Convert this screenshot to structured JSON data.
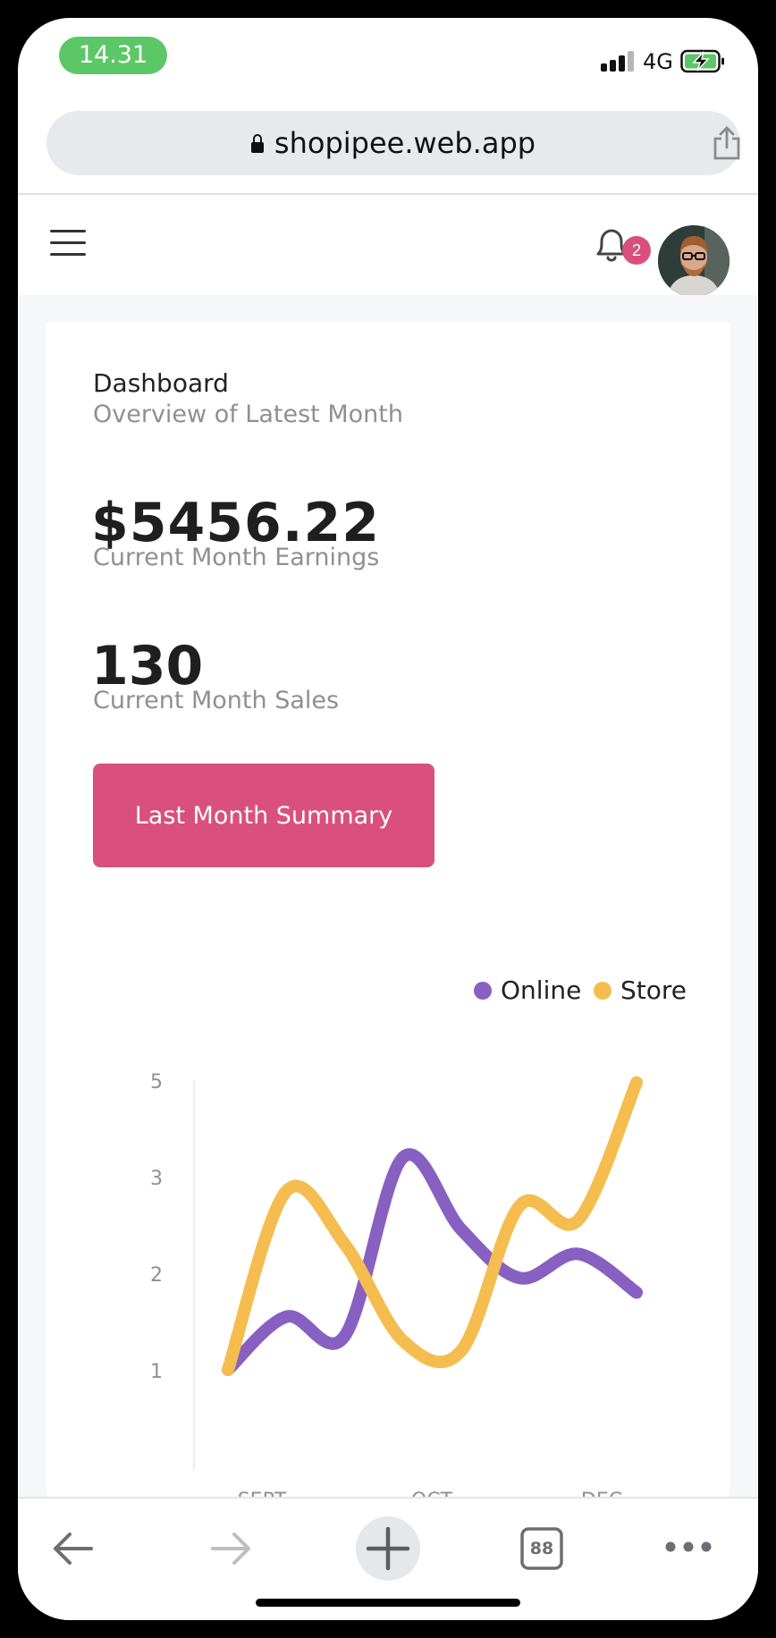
{
  "status_bar": {
    "time": "14.31",
    "network": "4G",
    "icons": [
      "signal-bars-icon",
      "battery-charging-icon"
    ]
  },
  "browser": {
    "url": "shopipee.web.app",
    "icons": [
      "lock-icon",
      "share-icon"
    ]
  },
  "header": {
    "notification_count": "2",
    "icons": [
      "hamburger-menu-icon",
      "bell-icon",
      "avatar"
    ]
  },
  "dashboard": {
    "title": "Dashboard",
    "subtitle": "Overview of Latest Month",
    "earnings_value": "$5456.22",
    "earnings_label": "Current Month Earnings",
    "sales_value": "130",
    "sales_label": "Current Month Sales",
    "summary_button": "Last Month Summary"
  },
  "colors": {
    "accent": "#d9507f",
    "online": "#8760c2",
    "store": "#f5bd4f",
    "status_green": "#5cc766"
  },
  "chart_data": {
    "type": "line",
    "smooth": true,
    "title": "",
    "xlabel": "",
    "ylabel": "",
    "y_ticks": [
      "5",
      "3",
      "2",
      "1"
    ],
    "x_tick_labels": [
      "SEPT",
      "OCT",
      "DEC"
    ],
    "legend_position": "top-right",
    "grid": false,
    "series": [
      {
        "name": "Online",
        "color": "#8760c2",
        "values": [
          1,
          1.55,
          1.35,
          3.4,
          2.45,
          1.95,
          2.2,
          1.8
        ]
      },
      {
        "name": "Store",
        "color": "#f5bd4f",
        "values": [
          1,
          2.85,
          2.3,
          1.3,
          1.2,
          2.7,
          2.55,
          4.95
        ]
      }
    ]
  },
  "toolbar": {
    "tabs_count": "88",
    "icons": [
      "back-arrow-icon",
      "forward-arrow-icon",
      "new-tab-plus-icon",
      "tabs-icon",
      "more-dots-icon"
    ]
  }
}
